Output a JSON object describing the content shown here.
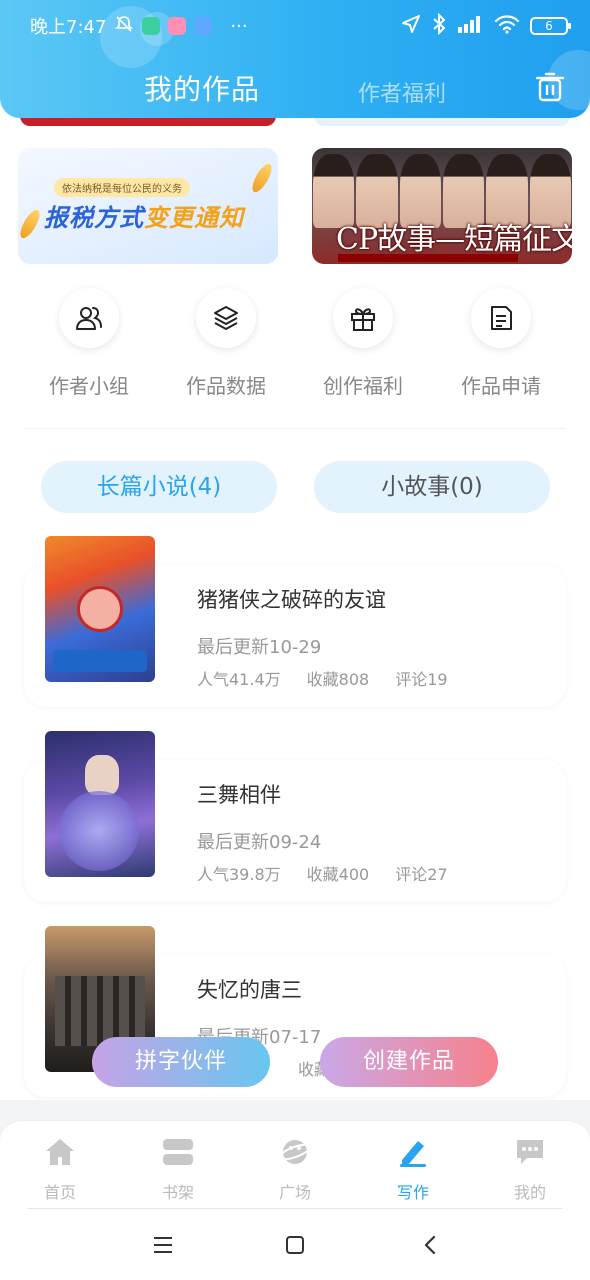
{
  "status_bar": {
    "time": "晚上7:47",
    "more": "···",
    "battery": "6"
  },
  "header": {
    "tab_active": "我的作品",
    "tab_inactive": "作者福利",
    "trash_icon": "trash-icon",
    "colors": {
      "gradient_start": "#5bc8f5",
      "gradient_end": "#1f9fee"
    }
  },
  "banners": {
    "tax": {
      "small_text": "依法纳税是每位公民的义务",
      "title_part1": "报税方式",
      "title_part2": "变更通知"
    },
    "cp": {
      "title": "CP故事—短篇征文"
    }
  },
  "quick_actions": [
    {
      "label": "作者小组",
      "icon": "author-group-icon"
    },
    {
      "label": "作品数据",
      "icon": "layers-icon"
    },
    {
      "label": "创作福利",
      "icon": "gift-icon"
    },
    {
      "label": "作品申请",
      "icon": "document-icon"
    }
  ],
  "segments": {
    "long": "长篇小说(4)",
    "short": "小故事(0)"
  },
  "books": [
    {
      "title": "猪猪侠之破碎的友谊",
      "updated": "最后更新10-29",
      "popularity": "人气41.4万",
      "favorites": "收藏808",
      "comments": "评论19"
    },
    {
      "title": "三舞相伴",
      "updated": "最后更新09-24",
      "popularity": "人气39.8万",
      "favorites": "收藏400",
      "comments": "评论27"
    },
    {
      "title": "失忆的唐三",
      "updated": "最后更新07-17",
      "favorites_partial": "收藏"
    }
  ],
  "floating_buttons": {
    "partner": "拼字伙伴",
    "create": "创建作品"
  },
  "bottom_nav": [
    {
      "label": "首页",
      "icon": "home-icon"
    },
    {
      "label": "书架",
      "icon": "bookshelf-icon"
    },
    {
      "label": "广场",
      "icon": "planet-icon"
    },
    {
      "label": "写作",
      "icon": "pen-icon",
      "active": true
    },
    {
      "label": "我的",
      "icon": "chat-bubble-icon"
    }
  ],
  "accent_color": "#2aa4ee"
}
